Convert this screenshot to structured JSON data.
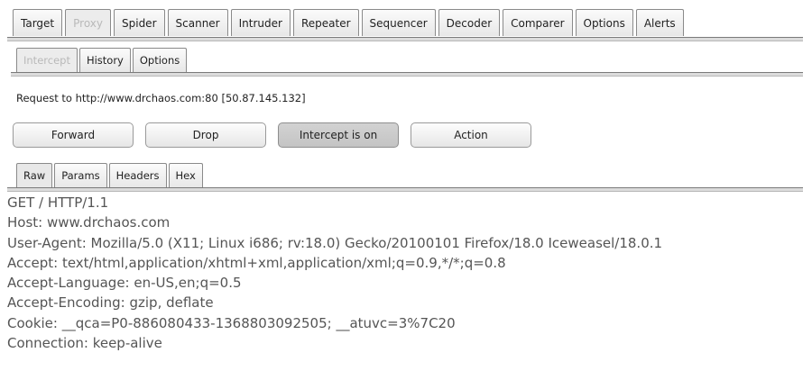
{
  "top_tabs": [
    "Target",
    "Proxy",
    "Spider",
    "Scanner",
    "Intruder",
    "Repeater",
    "Sequencer",
    "Decoder",
    "Comparer",
    "Options",
    "Alerts"
  ],
  "top_tabs_active": "Proxy",
  "sub_tabs": [
    "Intercept",
    "History",
    "Options"
  ],
  "sub_tabs_active": "Intercept",
  "request_info": "Request to http://www.drchaos.com:80  [50.87.145.132]",
  "buttons": {
    "forward": "Forward",
    "drop": "Drop",
    "intercept": "Intercept is on",
    "action": "Action"
  },
  "view_tabs": [
    "Raw",
    "Params",
    "Headers",
    "Hex"
  ],
  "view_tabs_active": "Raw",
  "request_lines": [
    "GET / HTTP/1.1",
    "Host: www.drchaos.com",
    "User-Agent: Mozilla/5.0 (X11; Linux i686; rv:18.0) Gecko/20100101 Firefox/18.0 Iceweasel/18.0.1",
    "Accept: text/html,application/xhtml+xml,application/xml;q=0.9,*/*;q=0.8",
    "Accept-Language: en-US,en;q=0.5",
    "Accept-Encoding: gzip, deflate",
    "Cookie: __qca=P0-886080433-1368803092505; __atuvc=3%7C20",
    "Connection: keep-alive"
  ]
}
